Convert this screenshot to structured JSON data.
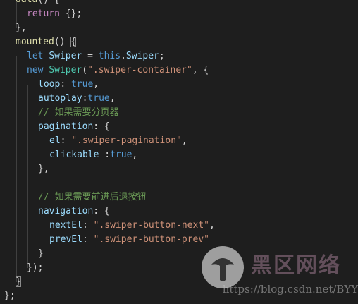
{
  "editor": {
    "theme": "dark",
    "lines": [
      "data() {",
      "return {};",
      "},",
      "mounted() {",
      "let Swiper = this.Swiper;",
      "new Swiper(\".swiper-container\", {",
      "loop: true,",
      "autoplay:true,",
      "// 如果需要分页器",
      "pagination: {",
      "el: \".swiper-pagination\",",
      "clickable :true,",
      "},",
      "",
      "// 如果需要前进后退按钮",
      "navigation: {",
      "nextEl: \".swiper-button-next\",",
      "prevEl: \".swiper-button-prev\"",
      "}",
      "});",
      "}",
      "};"
    ],
    "tokens": {
      "data": "data",
      "return": "return",
      "mounted": "mounted",
      "let": "let",
      "Swiper": "Swiper",
      "this": "this",
      "new": "new",
      "swiper_container": "\".swiper-container\"",
      "loop": "loop",
      "true": "true",
      "autoplay": "autoplay",
      "comment_pagination": "// 如果需要分页器",
      "pagination": "pagination",
      "el": "el",
      "swiper_pagination": "\".swiper-pagination\"",
      "clickable": "clickable",
      "comment_navigation": "// 如果需要前进后退按钮",
      "navigation": "navigation",
      "nextEl": "nextEl",
      "swiper_button_next": "\".swiper-button-next\"",
      "prevEl": "prevEl",
      "swiper_button_prev": "\".swiper-button-prev\""
    }
  },
  "watermark": {
    "title": "黑区网络",
    "url": "https://blog.csdn.net/BYY"
  },
  "colors": {
    "background": "#1e1e1e",
    "keyword": "#569cd6",
    "control": "#c586c0",
    "function": "#dcdcaa",
    "variable": "#9cdcfe",
    "class": "#4ec9b0",
    "string": "#ce9178",
    "comment": "#6a9955"
  }
}
